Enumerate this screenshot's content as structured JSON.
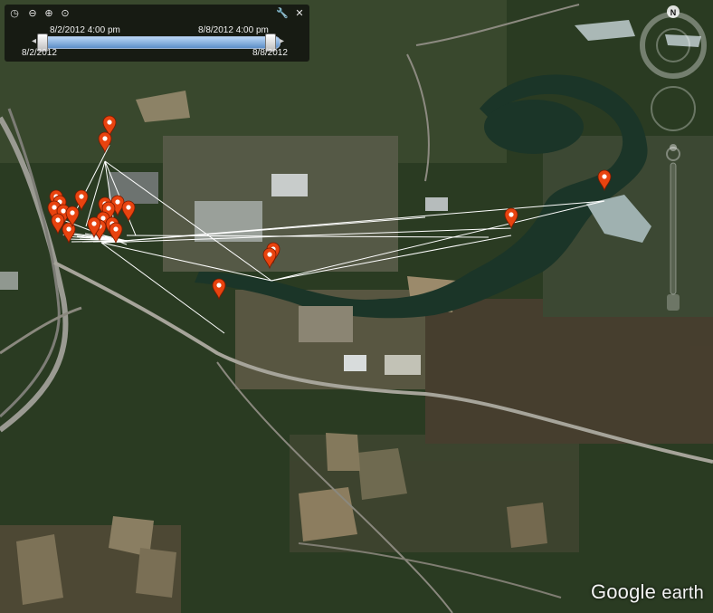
{
  "timeline": {
    "start_top": "8/2/2012    4:00 pm",
    "end_top": "8/8/2012    4:00 pm",
    "start_bottom": "8/2/2012",
    "end_bottom": "8/8/2012"
  },
  "compass_label": "N",
  "brand": {
    "main": "Google",
    "sub": "earth"
  },
  "colors": {
    "marker": "#e8430f",
    "track_line": "#ffffff",
    "water": "#1e3a2e",
    "forest": "#27391f"
  },
  "markers": {
    "count": 24,
    "icon": "map-pin-icon"
  }
}
